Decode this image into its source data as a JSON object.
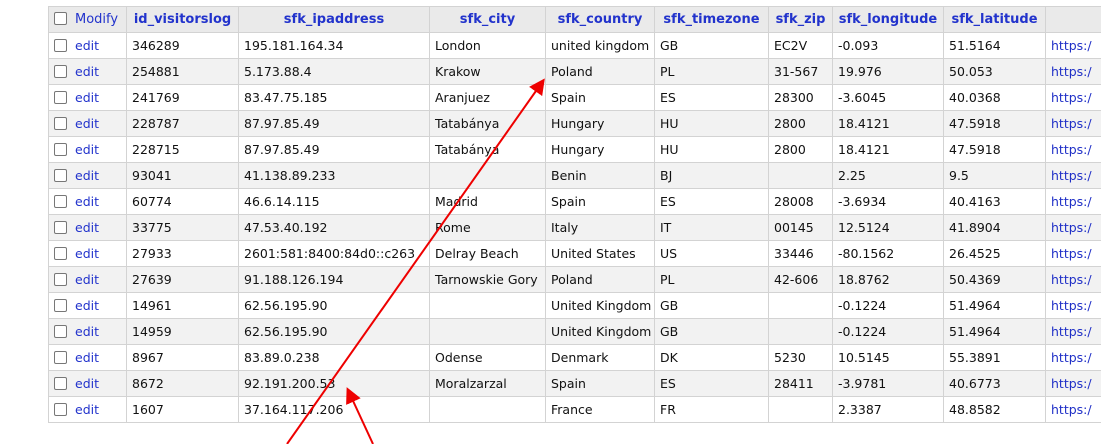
{
  "table": {
    "headers": {
      "modify": "Modify",
      "id": "id_visitorslog",
      "ip": "sfk_ipaddress",
      "city": "sfk_city",
      "country": "sfk_country",
      "timezone": "sfk_timezone",
      "zip": "sfk_zip",
      "longitude": "sfk_longitude",
      "latitude": "sfk_latitude"
    },
    "edit_label": "edit",
    "rows": [
      {
        "id": "346289",
        "ip": "195.181.164.34",
        "city": "London",
        "country": "united kingdom",
        "tz": "GB",
        "zip": "EC2V",
        "lon": "-0.093",
        "lat": "51.5164",
        "link": "https:/"
      },
      {
        "id": "254881",
        "ip": "5.173.88.4",
        "city": "Krakow",
        "country": "Poland",
        "tz": "PL",
        "zip": "31-567",
        "lon": "19.976",
        "lat": "50.053",
        "link": "https:/"
      },
      {
        "id": "241769",
        "ip": "83.47.75.185",
        "city": "Aranjuez",
        "country": "Spain",
        "tz": "ES",
        "zip": "28300",
        "lon": "-3.6045",
        "lat": "40.0368",
        "link": "https:/"
      },
      {
        "id": "228787",
        "ip": "87.97.85.49",
        "city": "Tatabánya",
        "country": "Hungary",
        "tz": "HU",
        "zip": "2800",
        "lon": "18.4121",
        "lat": "47.5918",
        "link": "https:/"
      },
      {
        "id": "228715",
        "ip": "87.97.85.49",
        "city": "Tatabánya",
        "country": "Hungary",
        "tz": "HU",
        "zip": "2800",
        "lon": "18.4121",
        "lat": "47.5918",
        "link": "https:/"
      },
      {
        "id": "93041",
        "ip": "41.138.89.233",
        "city": "",
        "country": "Benin",
        "tz": "BJ",
        "zip": "",
        "lon": "2.25",
        "lat": "9.5",
        "link": "https:/"
      },
      {
        "id": "60774",
        "ip": "46.6.14.115",
        "city": "Madrid",
        "country": "Spain",
        "tz": "ES",
        "zip": "28008",
        "lon": "-3.6934",
        "lat": "40.4163",
        "link": "https:/"
      },
      {
        "id": "33775",
        "ip": "47.53.40.192",
        "city": "Rome",
        "country": "Italy",
        "tz": "IT",
        "zip": "00145",
        "lon": "12.5124",
        "lat": "41.8904",
        "link": "https:/"
      },
      {
        "id": "27933",
        "ip": "2601:581:8400:84d0::c263",
        "city": "Delray Beach",
        "country": "United States",
        "tz": "US",
        "zip": "33446",
        "lon": "-80.1562",
        "lat": "26.4525",
        "link": "https:/"
      },
      {
        "id": "27639",
        "ip": "91.188.126.194",
        "city": "Tarnowskie Gory",
        "country": "Poland",
        "tz": "PL",
        "zip": "42-606",
        "lon": "18.8762",
        "lat": "50.4369",
        "link": "https:/"
      },
      {
        "id": "14961",
        "ip": "62.56.195.90",
        "city": "",
        "country": "United Kingdom",
        "tz": "GB",
        "zip": "",
        "lon": "-0.1224",
        "lat": "51.4964",
        "link": "https:/"
      },
      {
        "id": "14959",
        "ip": "62.56.195.90",
        "city": "",
        "country": "United Kingdom",
        "tz": "GB",
        "zip": "",
        "lon": "-0.1224",
        "lat": "51.4964",
        "link": "https:/"
      },
      {
        "id": "8967",
        "ip": "83.89.0.238",
        "city": "Odense",
        "country": "Denmark",
        "tz": "DK",
        "zip": "5230",
        "lon": "10.5145",
        "lat": "55.3891",
        "link": "https:/"
      },
      {
        "id": "8672",
        "ip": "92.191.200.53",
        "city": "Moralzarzal",
        "country": "Spain",
        "tz": "ES",
        "zip": "28411",
        "lon": "-3.9781",
        "lat": "40.6773",
        "link": "https:/"
      },
      {
        "id": "1607",
        "ip": "37.164.117.206",
        "city": "",
        "country": "France",
        "tz": "FR",
        "zip": "",
        "lon": "2.3387",
        "lat": "48.8582",
        "link": "https:/"
      }
    ]
  },
  "colors": {
    "header_text": "#2233cc",
    "annotation_arrow": "#ee0000"
  }
}
